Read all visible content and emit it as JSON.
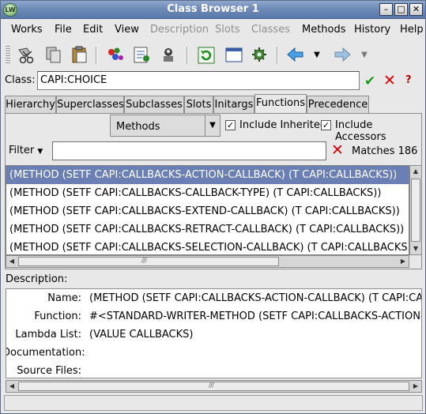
{
  "window": {
    "title": "Class Browser 1",
    "app_icon_text": "LW"
  },
  "menubar": {
    "items": [
      {
        "label": "Works",
        "disabled": false
      },
      {
        "label": "File",
        "disabled": false
      },
      {
        "label": "Edit",
        "disabled": false
      },
      {
        "label": "View",
        "disabled": false
      },
      {
        "label": "Description",
        "disabled": true
      },
      {
        "label": "Slots",
        "disabled": true
      },
      {
        "label": "Classes",
        "disabled": true
      },
      {
        "label": "Methods",
        "disabled": false
      },
      {
        "label": "History",
        "disabled": false
      },
      {
        "label": "Help",
        "disabled": false
      }
    ]
  },
  "toolbar": {
    "icons": [
      "cut-icon",
      "copy-icon",
      "paste-icon",
      "browse-objects-icon",
      "inspect-icon",
      "debug-icon",
      "refresh-icon",
      "window-icon",
      "settings-icon",
      "back-icon",
      "back-menu-icon",
      "forward-icon",
      "forward-menu-icon"
    ]
  },
  "class_row": {
    "label": "Class:",
    "value": "CAPI:CHOICE",
    "ok_glyph": "✔",
    "cancel_glyph": "✕",
    "help_glyph": "?"
  },
  "tabs": [
    {
      "label": "Hierarchy",
      "active": false
    },
    {
      "label": "Superclasses",
      "active": false
    },
    {
      "label": "Subclasses",
      "active": false
    },
    {
      "label": "Slots",
      "active": false
    },
    {
      "label": "Initargs",
      "active": false
    },
    {
      "label": "Functions",
      "active": true
    },
    {
      "label": "Precedence",
      "active": false
    }
  ],
  "functions": {
    "kind_select": "Methods",
    "include_inherited": {
      "label": "Include Inherited",
      "checked": true
    },
    "include_accessors": {
      "label": "Include Accessors",
      "checked": true
    },
    "filter": {
      "label": "Filter",
      "value": "",
      "matches": "Matches 186"
    },
    "rows": [
      "(METHOD (SETF CAPI:CALLBACKS-ACTION-CALLBACK) (T CAPI:CALLBACKS))",
      "(METHOD (SETF CAPI:CALLBACKS-CALLBACK-TYPE) (T CAPI:CALLBACKS))",
      "(METHOD (SETF CAPI:CALLBACKS-EXTEND-CALLBACK) (T CAPI:CALLBACKS))",
      "(METHOD (SETF CAPI:CALLBACKS-RETRACT-CALLBACK) (T CAPI:CALLBACKS))",
      "(METHOD (SETF CAPI:CALLBACKS-SELECTION-CALLBACK) (T CAPI:CALLBACKS))"
    ],
    "selected_index": 0
  },
  "description": {
    "label": "Description:",
    "fields": [
      {
        "key": "Name:",
        "value": "(METHOD (SETF CAPI:CALLBACKS-ACTION-CALLBACK) (T CAPI:CALLBACKS))"
      },
      {
        "key": "Function:",
        "value": "#<STANDARD-WRITER-METHOD (SETF CAPI:CALLBACKS-ACTION-CALLBACK) (T CAPI:CALLBACKS)>"
      },
      {
        "key": "Lambda List:",
        "value": "(VALUE CALLBACKS)"
      },
      {
        "key": "Documentation:",
        "value": ""
      },
      {
        "key": "Source Files:",
        "value": ""
      }
    ]
  },
  "colors": {
    "selection": "#6a7fb3",
    "title_bar": "#6f8bb8",
    "ok": "#1b9a1b",
    "cancel": "#dd0000"
  }
}
